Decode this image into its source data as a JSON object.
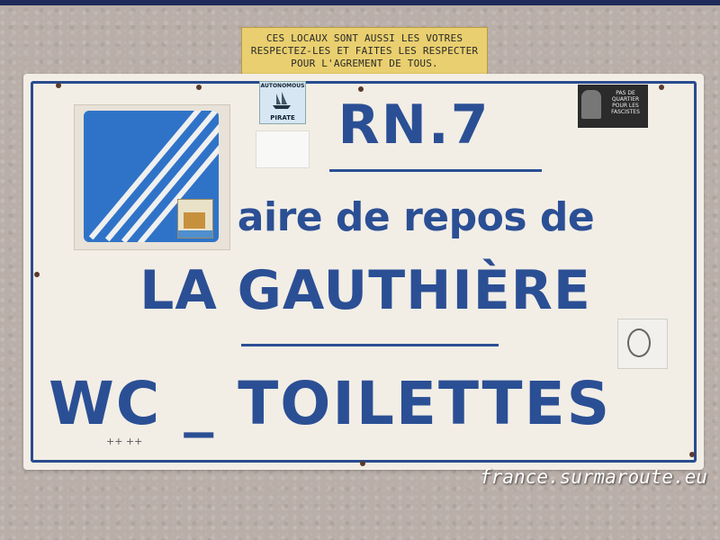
{
  "plaque": {
    "line1": "CES LOCAUX SONT AUSSI LES VOTRES",
    "line2": "RESPECTEZ-LES ET FAITES LES RESPECTER",
    "line3": "POUR L'AGREMENT DE TOUS."
  },
  "sign": {
    "route": "RN.7",
    "rest_area": "aire de repos de",
    "place": "LA GAUTHIÈRE",
    "facilities": "WC _ TOILETTES"
  },
  "stickers": {
    "pirate_top": "AUTONOMOUS",
    "pirate_bottom": "PIRATE",
    "antifa_text": "PAS DE QUARTIER POUR LES FASCISTES"
  },
  "graffiti": "++ ++",
  "watermark": "france.surmaroute.eu",
  "colors": {
    "sign_blue": "#2b4f94",
    "plaque_yellow": "#e9cf6f",
    "logo_blue": "#2f73c8"
  }
}
